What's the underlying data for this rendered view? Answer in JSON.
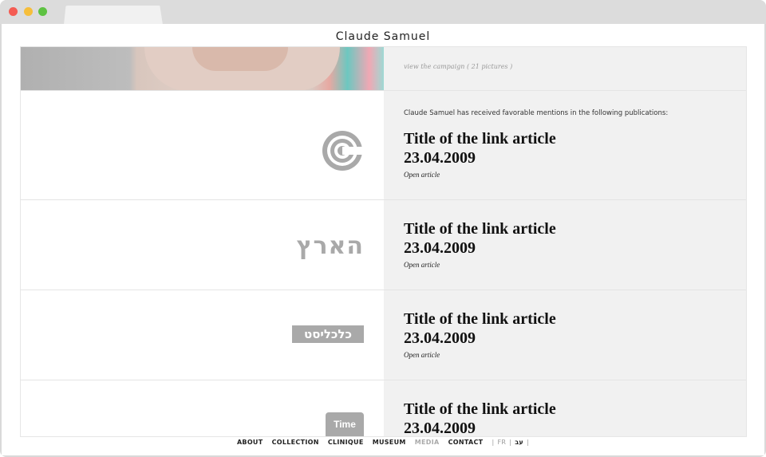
{
  "site": {
    "logo_text": "Claude Samuel"
  },
  "campaign": {
    "link_text": "view the campaign ( 21 pictures )"
  },
  "mentions": {
    "intro": "Claude Samuel has received favorable mentions in the following publications:"
  },
  "articles": [
    {
      "title": "Title of the link article",
      "date": "23.04.2009",
      "open": "Open article",
      "logo": "concentric-circles-logo"
    },
    {
      "title": "Title of the link article",
      "date": "23.04.2009",
      "open": "Open article",
      "logo": "haaretz-logo",
      "logo_text": "הארץ"
    },
    {
      "title": "Title of the link article",
      "date": "23.04.2009",
      "open": "Open article",
      "logo": "calcalist-logo",
      "logo_text": "כלכליסט"
    },
    {
      "title": "Title of the link article",
      "date": "23.04.2009",
      "logo": "timeout-logo",
      "logo_text": "Time Out"
    }
  ],
  "footer": {
    "nav": [
      "ABOUT",
      "COLLECTION",
      "CLINIQUE",
      "MUSEUM",
      "MEDIA",
      "CONTACT"
    ],
    "active": "MEDIA",
    "lang_sep_1": "|",
    "lang_fr": "FR",
    "lang_sep_2": "|",
    "lang_he": "עב",
    "lang_sep_3": "|"
  },
  "colors": {
    "panel": "#f1f1f1",
    "border": "#e4e4e4",
    "text": "#111111",
    "muted": "#aaaaaa"
  }
}
